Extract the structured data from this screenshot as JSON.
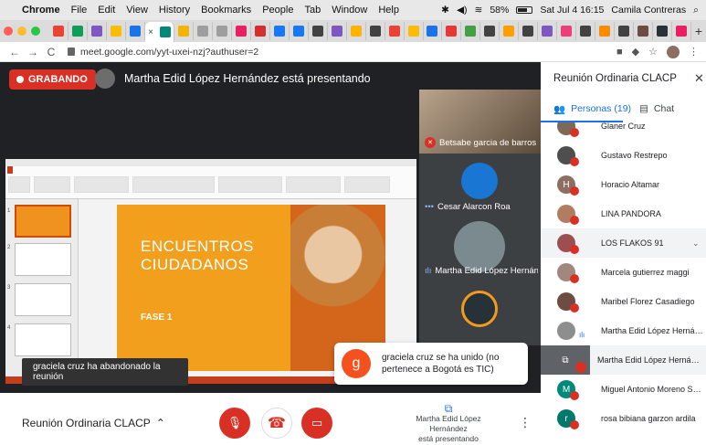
{
  "menubar": {
    "app": "Chrome",
    "items": [
      "File",
      "Edit",
      "View",
      "History",
      "Bookmarks",
      "People",
      "Tab",
      "Window",
      "Help"
    ],
    "battery": "58%",
    "battery_level": 0.58,
    "datetime": "Sat Jul 4  16:15",
    "user": "Camila Contreras"
  },
  "browser": {
    "url": "meet.google.com/yyt-uxei-nzj?authuser=2",
    "active_tab_close": "×",
    "new_tab": "+"
  },
  "meet": {
    "recording_label": "GRABANDO",
    "presenter_title": "Martha Edid López Hernández está presentando",
    "slide": {
      "title_line1": "ENCUENTROS",
      "title_line2": "CIUDADANOS",
      "fase": "FASE 1"
    },
    "tiles": [
      {
        "name": "Betsabe garcia de barros",
        "muted": true
      },
      {
        "name": "Cesar Alarcon Roa",
        "muted": false
      },
      {
        "name": "Martha Edid López Hernán...",
        "muted": false
      },
      {
        "name": "",
        "muted": false
      }
    ],
    "toast_left": "graciela cruz ha abandonado la reunión",
    "toast_right": {
      "initial": "g",
      "message": "graciela cruz se ha unido (no pertenece a Bogotá es TIC)"
    },
    "bottom": {
      "meeting_name": "Reunión Ordinaria CLACP",
      "present_line1": "Martha Edid López Hernández",
      "present_line2": "está presentando"
    }
  },
  "panel": {
    "title": "Reunión Ordinaria CLACP",
    "tab_people": "Personas (19)",
    "tab_chat": "Chat",
    "participants": [
      {
        "name": "Glaner Cruz",
        "initial": "",
        "color": "#7b6a58"
      },
      {
        "name": "Gustavo Restrepo",
        "initial": "",
        "color": "#4e4e4e"
      },
      {
        "name": "Horacio Altamar",
        "initial": "H",
        "color": "#8d6e63"
      },
      {
        "name": "LINA PANDORA",
        "initial": "",
        "color": "#b07d62"
      },
      {
        "name": "LOS FLAKOS 91",
        "initial": "",
        "color": "#9c4f4f",
        "group": true
      },
      {
        "name": "Marcela gutierrez maggi",
        "initial": "",
        "color": "#a1887f"
      },
      {
        "name": "Maribel Florez Casadiego",
        "initial": "",
        "color": "#6d4c41"
      },
      {
        "name": "Martha Edid López Hernández",
        "initial": "",
        "color": "#8e8e8e"
      },
      {
        "name": "Martha Edid López Hernández ...",
        "initial": "",
        "color": "#5f6368",
        "presentation": true
      },
      {
        "name": "Miguel Antonio Moreno Sarmie...",
        "initial": "M",
        "color": "#00897b"
      },
      {
        "name": "rosa bibiana garzon ardila",
        "initial": "r",
        "color": "#00796b"
      }
    ]
  }
}
